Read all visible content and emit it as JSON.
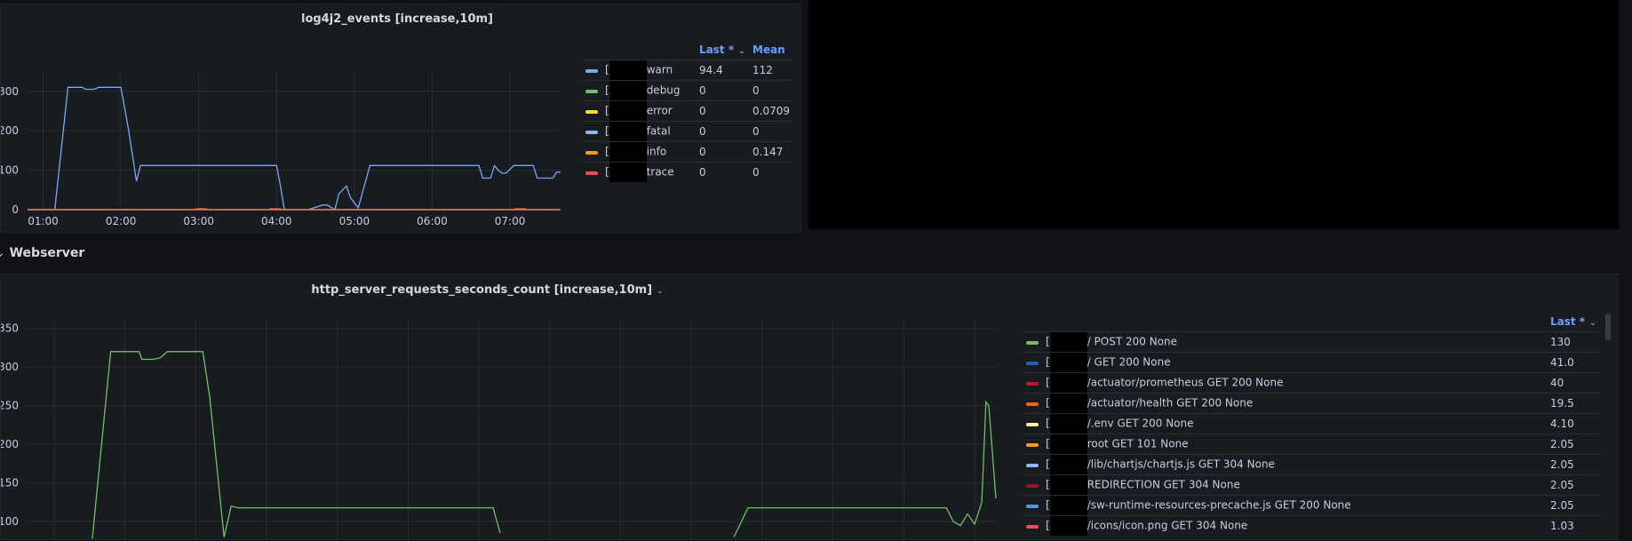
{
  "panel1": {
    "title": "log4j2_events [increase,10m]",
    "legend": {
      "headers": {
        "last": "Last *",
        "mean": "Mean"
      },
      "rows": [
        {
          "label": "warn",
          "color": "#7ea6f2",
          "last": "94.4",
          "mean": "112"
        },
        {
          "label": "debug",
          "color": "#73bf69",
          "last": "0",
          "mean": "0"
        },
        {
          "label": "error",
          "color": "#fade2a",
          "last": "0",
          "mean": "0.0709"
        },
        {
          "label": "fatal",
          "color": "#8ab8ff",
          "last": "0",
          "mean": "0"
        },
        {
          "label": "info",
          "color": "#ff9830",
          "last": "0",
          "mean": "0.147"
        },
        {
          "label": "trace",
          "color": "#f2495c",
          "last": "0",
          "mean": "0"
        }
      ]
    }
  },
  "section": {
    "title": "Webserver"
  },
  "panel2": {
    "title": "http_server_requests_seconds_count [increase,10m]",
    "legend": {
      "headers": {
        "last": "Last *"
      },
      "rows": [
        {
          "label": "/ POST 200 None",
          "color": "#73bf69",
          "last": "130"
        },
        {
          "label": "/ GET 200 None",
          "color": "#1f60c4",
          "last": "41.0"
        },
        {
          "label": "/actuator/prometheus GET 200 None",
          "color": "#c4162a",
          "last": "40"
        },
        {
          "label": "/actuator/health GET 200 None",
          "color": "#fa6400",
          "last": "19.5"
        },
        {
          "label": "/.env GET 200 None",
          "color": "#fff899",
          "last": "4.10"
        },
        {
          "label": "root GET 101 None",
          "color": "#ff9830",
          "last": "2.05"
        },
        {
          "label": "/lib/chartjs/chartjs.js GET 304 None",
          "color": "#8ab8ff",
          "last": "2.05"
        },
        {
          "label": "REDIRECTION GET 304 None",
          "color": "#8f1d1d",
          "last": "2.05"
        },
        {
          "label": "/sw-runtime-resources-precache.js GET 200 None",
          "color": "#5794f2",
          "last": "2.05"
        },
        {
          "label": "/icons/icon.png GET 304 None",
          "color": "#f2495c",
          "last": "1.03"
        }
      ]
    }
  },
  "chart_data": [
    {
      "type": "line",
      "title": "log4j2_events [increase,10m]",
      "x_ticks": [
        "01:00",
        "02:00",
        "03:00",
        "04:00",
        "05:00",
        "06:00",
        "07:00"
      ],
      "y_ticks": [
        0,
        100,
        200,
        300
      ],
      "ylim": [
        0,
        340
      ],
      "xlim_hours": [
        0.8,
        7.65
      ],
      "series": [
        {
          "name": "warn",
          "color": "#7ea6f2",
          "x": [
            0.8,
            1.15,
            1.32,
            1.5,
            1.55,
            1.65,
            1.72,
            1.8,
            2.0,
            2.1,
            2.2,
            2.25,
            2.3,
            2.4,
            3.0,
            3.5,
            4.0,
            4.05,
            4.1,
            4.2,
            4.4,
            4.6,
            4.65,
            4.75,
            4.8,
            4.9,
            4.95,
            5.05,
            5.2,
            5.3,
            5.5,
            6.0,
            6.6,
            6.65,
            6.75,
            6.8,
            6.85,
            6.9,
            6.95,
            7.05,
            7.2,
            7.3,
            7.35,
            7.45,
            7.55,
            7.6,
            7.65
          ],
          "y": [
            0,
            0,
            310,
            310,
            305,
            305,
            310,
            310,
            310,
            200,
            72,
            112,
            112,
            112,
            112,
            112,
            112,
            60,
            0,
            0,
            0,
            12,
            12,
            0,
            40,
            60,
            30,
            5,
            112,
            112,
            112,
            112,
            112,
            80,
            80,
            112,
            100,
            92,
            93,
            112,
            112,
            112,
            80,
            80,
            80,
            95,
            95
          ]
        },
        {
          "name": "debug",
          "color": "#73bf69",
          "x": [
            0.8,
            7.65
          ],
          "y": [
            0,
            0
          ]
        },
        {
          "name": "error",
          "color": "#fade2a",
          "x": [
            0.8,
            7.65
          ],
          "y": [
            0,
            0
          ]
        },
        {
          "name": "fatal",
          "color": "#8ab8ff",
          "x": [
            0.8,
            7.65
          ],
          "y": [
            0,
            0
          ]
        },
        {
          "name": "info",
          "color": "#ff9830",
          "x": [
            0.8,
            2.95,
            2.96,
            3.1,
            3.11,
            3.9,
            3.91,
            4.05,
            4.06,
            7.05,
            7.06,
            7.2,
            7.21,
            7.65
          ],
          "y": [
            0,
            0,
            2,
            2,
            0,
            0,
            2,
            2,
            0,
            0,
            2,
            2,
            0,
            0
          ]
        },
        {
          "name": "trace",
          "color": "#f2495c",
          "x": [
            0.8,
            7.65
          ],
          "y": [
            0,
            0
          ]
        }
      ]
    },
    {
      "type": "line",
      "title": "http_server_requests_seconds_count [increase,10m]",
      "y_ticks": [
        100,
        150,
        200,
        250,
        300,
        350
      ],
      "ylim": [
        75,
        360
      ],
      "xlim_hours": [
        0.8,
        7.65
      ],
      "series": [
        {
          "name": "/ POST 200 None",
          "color": "#73bf69",
          "x": [
            1.27,
            1.4,
            1.45,
            1.6,
            1.62,
            1.7,
            1.75,
            1.8,
            1.9,
            2.0,
            2.05,
            2.1,
            2.15,
            2.2,
            2.25,
            2.3,
            2.4,
            3.0,
            3.5,
            4.0,
            4.1,
            4.15
          ],
          "y": [
            78,
            320,
            320,
            320,
            310,
            310,
            312,
            320,
            320,
            320,
            320,
            260,
            170,
            80,
            120,
            118,
            118,
            118,
            118,
            118,
            118,
            85
          ],
          "x2": [
            5.8,
            5.9,
            6.0,
            6.5,
            7.0,
            7.3,
            7.35,
            7.4,
            7.45,
            7.5,
            7.55,
            7.58,
            7.6,
            7.65
          ],
          "y2": [
            80,
            118,
            118,
            118,
            118,
            118,
            100,
            95,
            110,
            97,
            125,
            255,
            250,
            130
          ]
        }
      ]
    }
  ]
}
